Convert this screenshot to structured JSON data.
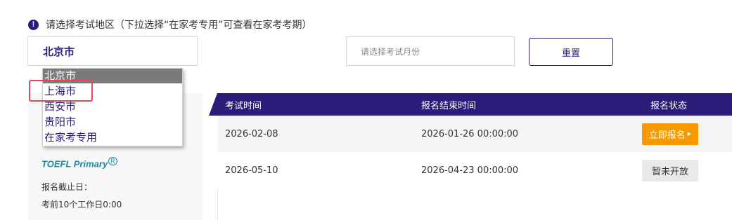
{
  "notice": {
    "icon": "exclamation-icon",
    "text": "请选择考试地区（下拉选择“在家考专用”可查看在家考考期）"
  },
  "region_select": {
    "value": "北京市"
  },
  "region_dropdown": {
    "options": [
      "北京市",
      "上海市",
      "西安市",
      "贵阳市",
      "在家考专用"
    ],
    "selected_index": 0,
    "highlighted_option": "上海市"
  },
  "month_select": {
    "placeholder": "请选择考试月份"
  },
  "reset_label": "重置",
  "left_card": {
    "logo_text": "TOEFL Primary",
    "logo_mark": "R",
    "deadline_label": "报名截止日：",
    "deadline_value": "考前10个工作日0:00"
  },
  "table": {
    "headers": [
      "考试时间",
      "报名结束时间",
      "报名状态"
    ],
    "rows": [
      {
        "exam_date": "2026-02-08",
        "end_time": "2026-01-26 00:00:00",
        "status": "立即报名",
        "status_icon": "caret-right-icon",
        "open": true
      },
      {
        "exam_date": "2026-05-10",
        "end_time": "2026-04-23 00:00:00",
        "status": "暂未开放",
        "open": false
      }
    ]
  },
  "colors": {
    "brand": "#2d1b7a",
    "open_button": "#f59a00",
    "closed_button": "#e9e9e9",
    "highlight": "#e5484d"
  }
}
